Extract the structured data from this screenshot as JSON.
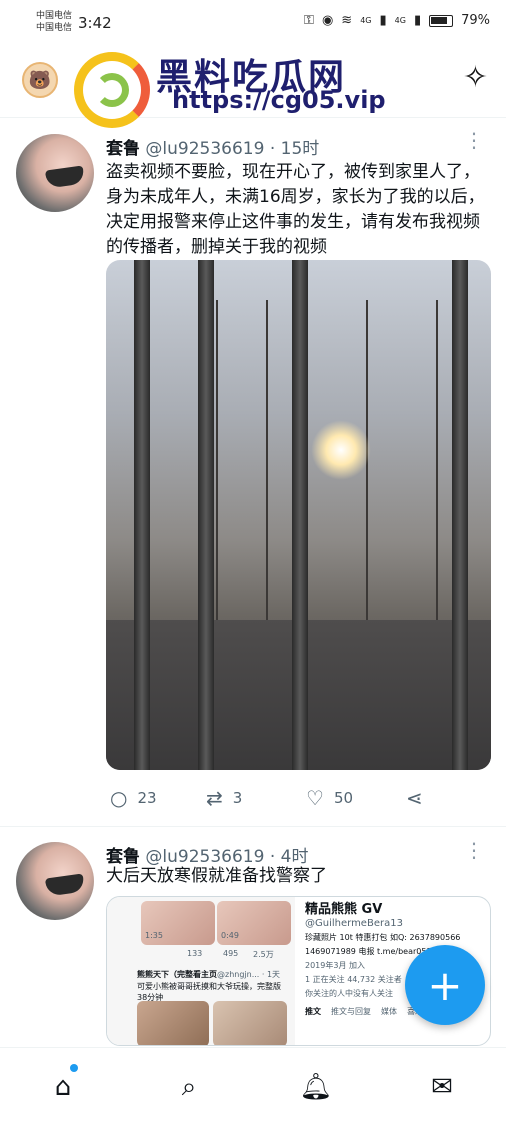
{
  "status_bar": {
    "carrier_1": "中国电信",
    "carrier_2": "中国电信",
    "time": "3:42",
    "signal_1": "4G",
    "signal_2": "4G",
    "battery": "79%"
  },
  "header": {
    "watermark_title": "黑料吃瓜网",
    "watermark_url": "https://cg05.vip"
  },
  "tweets": [
    {
      "name": "套鲁",
      "handle": "@lu92536619",
      "time": "· 15时",
      "text": "盗卖视频不要脸，现在开心了，被传到家里人了，身为未成年人，未满16周岁，家长为了我的以后，决定用报警来停止这件事的发生，请有发布我视频的传播者，删掉关于我的视频",
      "replies": "23",
      "retweets": "3",
      "likes": "50"
    },
    {
      "name": "套鲁",
      "handle": "@lu92536619",
      "time": "· 4时",
      "text": "大后天放寒假就准备找警察了",
      "embed": {
        "profile_title": "精品熊熊 GV",
        "profile_handle": "@GuilhermeBera13",
        "profile_bio": "珍藏照片 10t 特惠打包 如Q: 2637890566",
        "profile_bio2": "1469071989 电报 t.me/bear053",
        "joined": "2019年3月 加入",
        "following": "1 正在关注",
        "followers": "44,732 关注者",
        "tab1": "推文",
        "tab2": "推文与回复",
        "tab3": "媒体",
        "tab4": "喜欢",
        "no_followers": "你关注的人中没有人关注",
        "dur1": "1:35",
        "dur2": "0:49",
        "stat1": "133",
        "stat2": "495",
        "stat3": "2.5万",
        "quoted_name": "熊熊天下（完整看主页",
        "quoted_handle": "@zhngjn... · 1天",
        "quoted_text": "可爱小熊被哥哥抚摸和大爷玩操，完整版38分钟"
      }
    }
  ],
  "fab": {
    "label": "+"
  }
}
